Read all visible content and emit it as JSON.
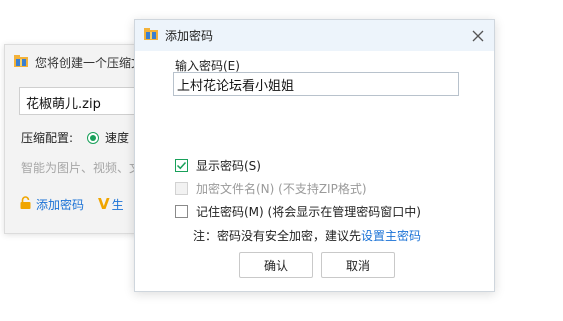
{
  "background_window": {
    "title": "您将创建一个压缩文",
    "filename": "花椒萌儿.zip",
    "config_label": "压缩配置:",
    "config_option": "速度",
    "hint": "智能为图片、视频、文",
    "add_password_link": "添加密码",
    "generate_link": "生"
  },
  "dialog": {
    "title": "添加密码",
    "password_label": "输入密码(E)",
    "password_value": "上村花论坛看小姐姐",
    "show_password": {
      "label": "显示密码(S)",
      "checked": true
    },
    "encrypt_filenames": {
      "label": "加密文件名(N) (不支持ZIP格式)",
      "checked": false,
      "disabled": true
    },
    "remember_password": {
      "label": "记住密码(M) (将会显示在管理密码窗口中)",
      "checked": false
    },
    "note_prefix": "注：密码没有安全加密，建议先",
    "note_link": "设置主密码",
    "ok_button": "确认",
    "cancel_button": "取消"
  },
  "colors": {
    "accent_green": "#19a05a",
    "link_blue": "#1a72d6",
    "titlebar_bg": "#edf4fb",
    "disabled_text": "#9a9a9a"
  },
  "icons": [
    "archive-icon",
    "close-icon",
    "checkmark-icon",
    "lock-icon",
    "v-mark-icon"
  ]
}
